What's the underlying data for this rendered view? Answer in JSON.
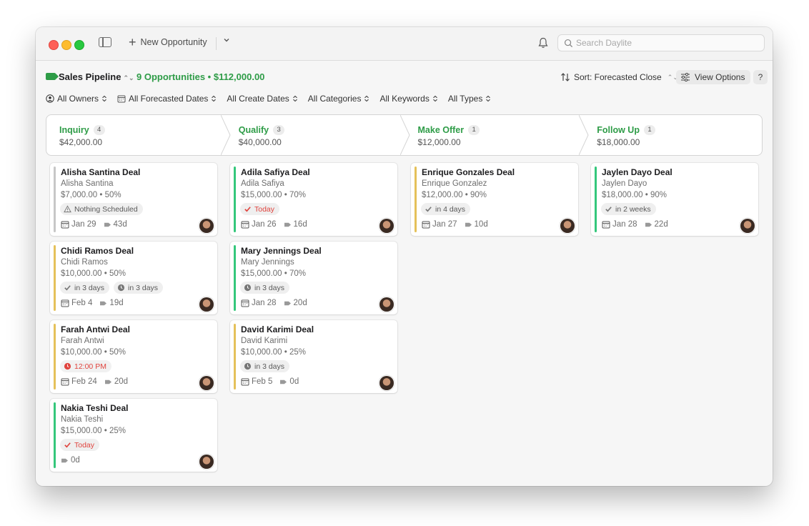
{
  "toolbar": {
    "new_opportunity": "New Opportunity",
    "search_placeholder": "Search Daylite"
  },
  "header": {
    "pipeline_name": "Sales Pipeline",
    "summary": "9 Opportunities • $112,000.00",
    "sort_label": "Sort: Forecasted Close",
    "view_options": "View Options",
    "help": "?"
  },
  "filters": [
    {
      "label": "All Owners",
      "icon": "person-circle-icon"
    },
    {
      "label": "All Forecasted Dates",
      "icon": "calendar-icon"
    },
    {
      "label": "All Create Dates"
    },
    {
      "label": "All Categories"
    },
    {
      "label": "All Keywords"
    },
    {
      "label": "All Types"
    }
  ],
  "colors": {
    "accent": "#2e9c47",
    "gray_bar": "#c7c7c7",
    "yellow_bar": "#e5c15a",
    "green_bar": "#34c77b",
    "red": "#e0443e"
  },
  "stages": [
    {
      "name": "Inquiry",
      "count": "4",
      "total": "$42,000.00"
    },
    {
      "name": "Qualify",
      "count": "3",
      "total": "$40,000.00"
    },
    {
      "name": "Make Offer",
      "count": "1",
      "total": "$12,000.00"
    },
    {
      "name": "Follow Up",
      "count": "1",
      "total": "$18,000.00"
    }
  ],
  "columns": [
    [
      {
        "title": "Alisha Santina Deal",
        "contact": "Alisha Santina",
        "amount": "$7,000.00 • 50%",
        "bar": "gray",
        "chips": [
          {
            "icon": "warning-icon",
            "text": "Nothing Scheduled",
            "style": "normal"
          }
        ],
        "date": "Jan 29",
        "age": "43d"
      },
      {
        "title": "Chidi Ramos Deal",
        "contact": "Chidi Ramos",
        "amount": "$10,000.00 • 50%",
        "bar": "yellow",
        "chips": [
          {
            "icon": "checkmark-icon",
            "text": "in 3 days",
            "style": "normal"
          },
          {
            "icon": "clock-icon",
            "text": "in 3 days",
            "style": "normal"
          }
        ],
        "date": "Feb 4",
        "age": "19d"
      },
      {
        "title": "Farah Antwi Deal",
        "contact": "Farah Antwi",
        "amount": "$10,000.00 • 50%",
        "bar": "yellow",
        "chips": [
          {
            "icon": "alarm-icon",
            "text": "12:00 PM",
            "style": "redtime"
          }
        ],
        "date": "Feb 24",
        "age": "20d"
      },
      {
        "title": "Nakia Teshi Deal",
        "contact": "Nakia Teshi",
        "amount": "$15,000.00 • 25%",
        "bar": "green",
        "chips": [
          {
            "icon": "checkmark-icon",
            "text": "Today",
            "style": "red"
          }
        ],
        "date": "",
        "age": "0d"
      }
    ],
    [
      {
        "title": "Adila Safiya Deal",
        "contact": "Adila Safiya",
        "amount": "$15,000.00 • 70%",
        "bar": "green",
        "chips": [
          {
            "icon": "checkmark-icon",
            "text": "Today",
            "style": "red"
          }
        ],
        "date": "Jan 26",
        "age": "16d"
      },
      {
        "title": "Mary Jennings Deal",
        "contact": "Mary Jennings",
        "amount": "$15,000.00 • 70%",
        "bar": "green",
        "chips": [
          {
            "icon": "clock-icon",
            "text": "in 3 days",
            "style": "normal"
          }
        ],
        "date": "Jan 28",
        "age": "20d"
      },
      {
        "title": "David Karimi Deal",
        "contact": "David Karimi",
        "amount": "$10,000.00 • 25%",
        "bar": "yellow",
        "chips": [
          {
            "icon": "clock-icon",
            "text": "in 3 days",
            "style": "normal"
          }
        ],
        "date": "Feb 5",
        "age": "0d"
      }
    ],
    [
      {
        "title": "Enrique Gonzales Deal",
        "contact": "Enrique Gonzalez",
        "amount": "$12,000.00 • 90%",
        "bar": "yellow",
        "chips": [
          {
            "icon": "checkmark-icon",
            "text": "in 4 days",
            "style": "normal"
          }
        ],
        "date": "Jan 27",
        "age": "10d"
      }
    ],
    [
      {
        "title": "Jaylen Dayo Deal",
        "contact": "Jaylen Dayo",
        "amount": "$18,000.00 • 90%",
        "bar": "green",
        "chips": [
          {
            "icon": "checkmark-icon",
            "text": "in 2 weeks",
            "style": "normal"
          }
        ],
        "date": "Jan 28",
        "age": "22d"
      }
    ]
  ]
}
